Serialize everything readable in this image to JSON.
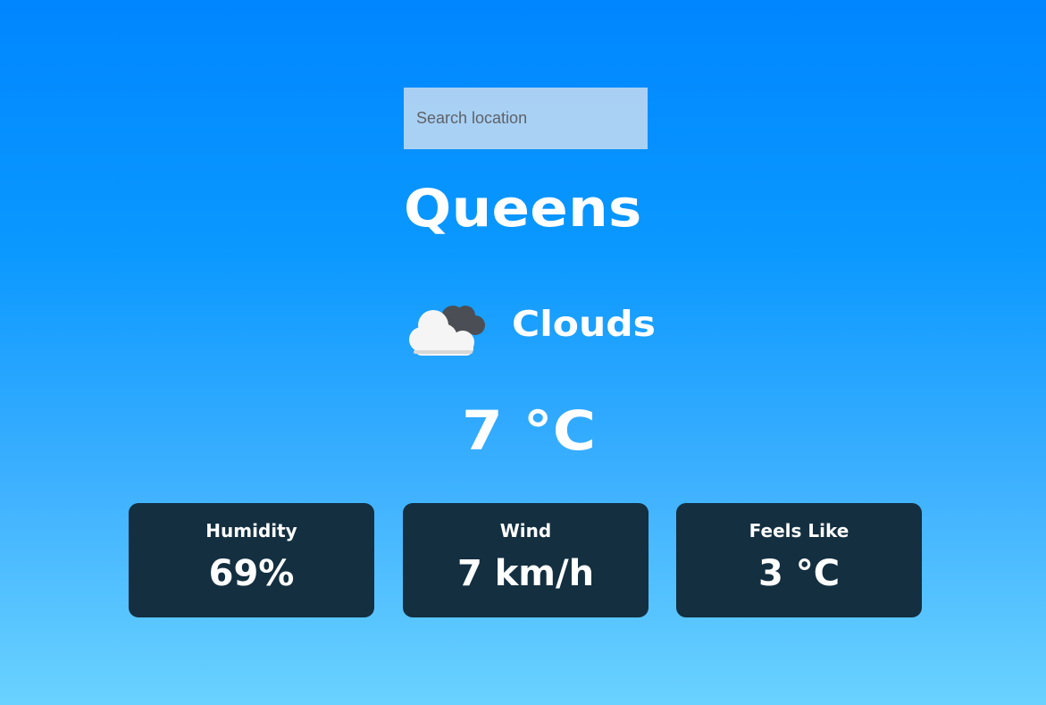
{
  "search": {
    "placeholder": "Search location"
  },
  "location": {
    "city": "Queens"
  },
  "weather": {
    "condition": "Clouds",
    "temperature": "7 °C",
    "icon": "clouds-icon"
  },
  "stats": [
    {
      "label": "Humidity",
      "value": "69%"
    },
    {
      "label": "Wind",
      "value": "7 km/h"
    },
    {
      "label": "Feels Like",
      "value": "3 °C"
    }
  ],
  "colors": {
    "background_top": "#0086ff",
    "background_bottom": "#6ad2ff",
    "card_background": "#132f40",
    "text": "#ffffff",
    "search_background": "#e3e8f0"
  }
}
